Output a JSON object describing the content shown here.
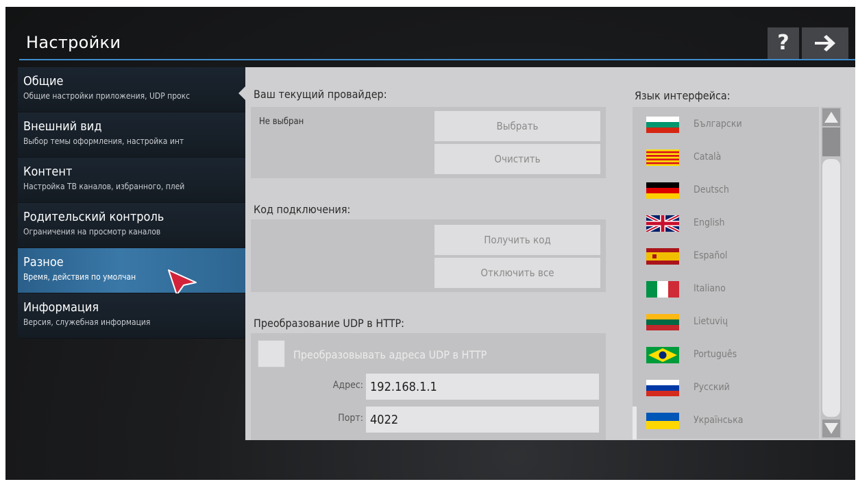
{
  "header": {
    "title": "Настройки",
    "help_label": "?"
  },
  "sidebar": {
    "items": [
      {
        "title": "Общие",
        "subtitle": "Общие настройки приложения, UDP прокс"
      },
      {
        "title": "Внешний вид",
        "subtitle": "Выбор темы оформления, настройка инт"
      },
      {
        "title": "Контент",
        "subtitle": "Настройка ТВ каналов, избранного, плей"
      },
      {
        "title": "Родительский контроль",
        "subtitle": "Ограничения на просмотр каналов"
      },
      {
        "title": "Разное",
        "subtitle": "Время, действия по умолчан"
      },
      {
        "title": "Информация",
        "subtitle": "Версия, служебная информация"
      }
    ],
    "active_index": 4
  },
  "provider": {
    "label": "Ваш текущий провайдер:",
    "value": "Не выбран",
    "select_button": "Выбрать",
    "clear_button": "Очистить"
  },
  "connection": {
    "label": "Код подключения:",
    "get_code_button": "Получить код",
    "disable_all_button": "Отключить все"
  },
  "udp": {
    "label": "Преобразование UDP в HTTP:",
    "checkbox_label": "Преобразовывать адреса UDP в HTTP",
    "checked": false,
    "address_label": "Адрес:",
    "address_value": "192.168.1.1",
    "port_label": "Порт:",
    "port_value": "4022"
  },
  "language": {
    "label": "Язык интерфейса:",
    "items": [
      {
        "name": "Български",
        "flag": "bulgaria"
      },
      {
        "name": "Català",
        "flag": "catalonia"
      },
      {
        "name": "Deutsch",
        "flag": "germany"
      },
      {
        "name": "English",
        "flag": "united-kingdom"
      },
      {
        "name": "Español",
        "flag": "spain"
      },
      {
        "name": "Italiano",
        "flag": "italy"
      },
      {
        "name": "Lietuvių",
        "flag": "lithuania"
      },
      {
        "name": "Português",
        "flag": "brazil"
      },
      {
        "name": "Русский",
        "flag": "russia"
      },
      {
        "name": "Українська",
        "flag": "ukraine"
      }
    ],
    "selected": "Русский"
  },
  "colors": {
    "accent": "#3f8fd0",
    "active_item": "#3a78a8",
    "panel": "#cfcfd1"
  }
}
